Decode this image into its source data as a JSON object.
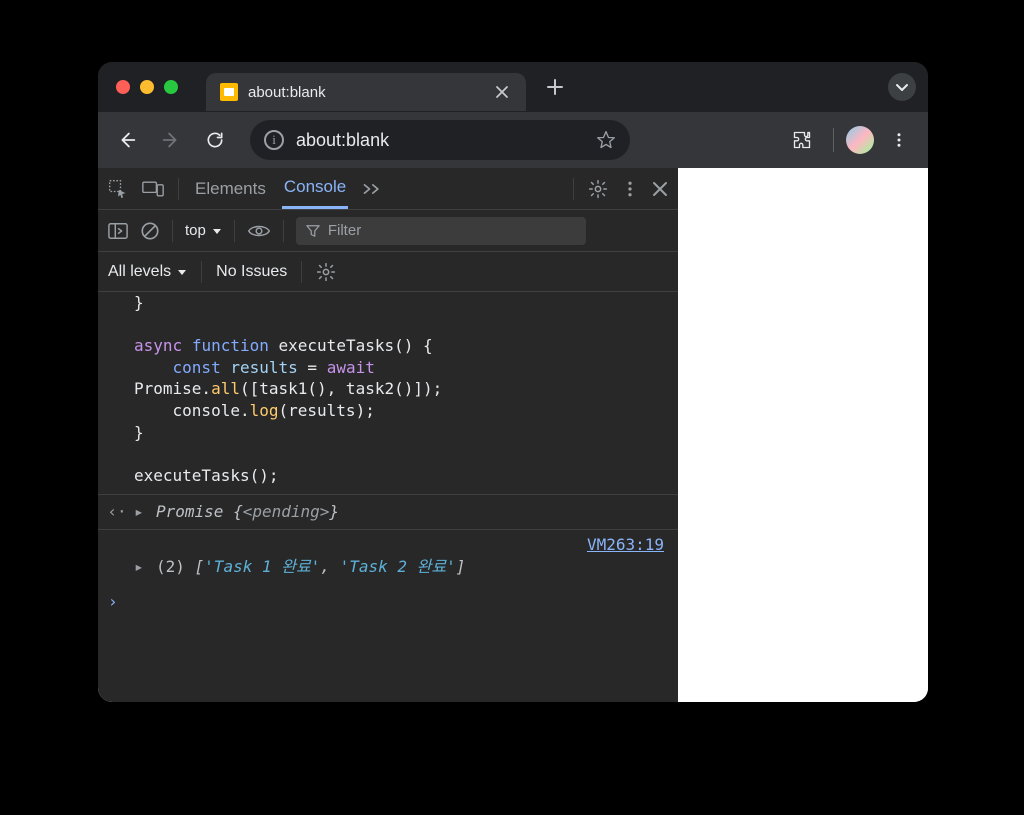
{
  "tab": {
    "title": "about:blank"
  },
  "omnibox": {
    "url": "about:blank"
  },
  "devtools": {
    "tabs": {
      "elements": "Elements",
      "console": "Console"
    }
  },
  "console_toolbar": {
    "context": "top",
    "filter_placeholder": "Filter",
    "levels": "All levels",
    "issues": "No Issues"
  },
  "code": {
    "brace_close": "}",
    "blank": "",
    "l1_async": "async",
    "l1_function": "function",
    "l1_name": "executeTasks",
    "l1_tail": "() {",
    "l2_indent": "    ",
    "l2_const": "const",
    "l2_results": "results",
    "l2_eq": " = ",
    "l2_await": "await",
    "l3": "Promise.",
    "l3_all": "all",
    "l3_tail": "([task1(), task2()]);",
    "l4_indent": "    ",
    "l4_console": "console.",
    "l4_log": "log",
    "l4_tail": "(results);",
    "l5": "}",
    "l7": "executeTasks();"
  },
  "output": {
    "promise_label": "Promise",
    "promise_open": " {",
    "promise_state": "<pending>",
    "promise_close": "}",
    "source_link": "VM263:19",
    "arr_count": "(2)",
    "arr_open": " [",
    "str1": "'Task 1 완료'",
    "comma": ", ",
    "str2": "'Task 2 완료'",
    "arr_close": "]"
  }
}
